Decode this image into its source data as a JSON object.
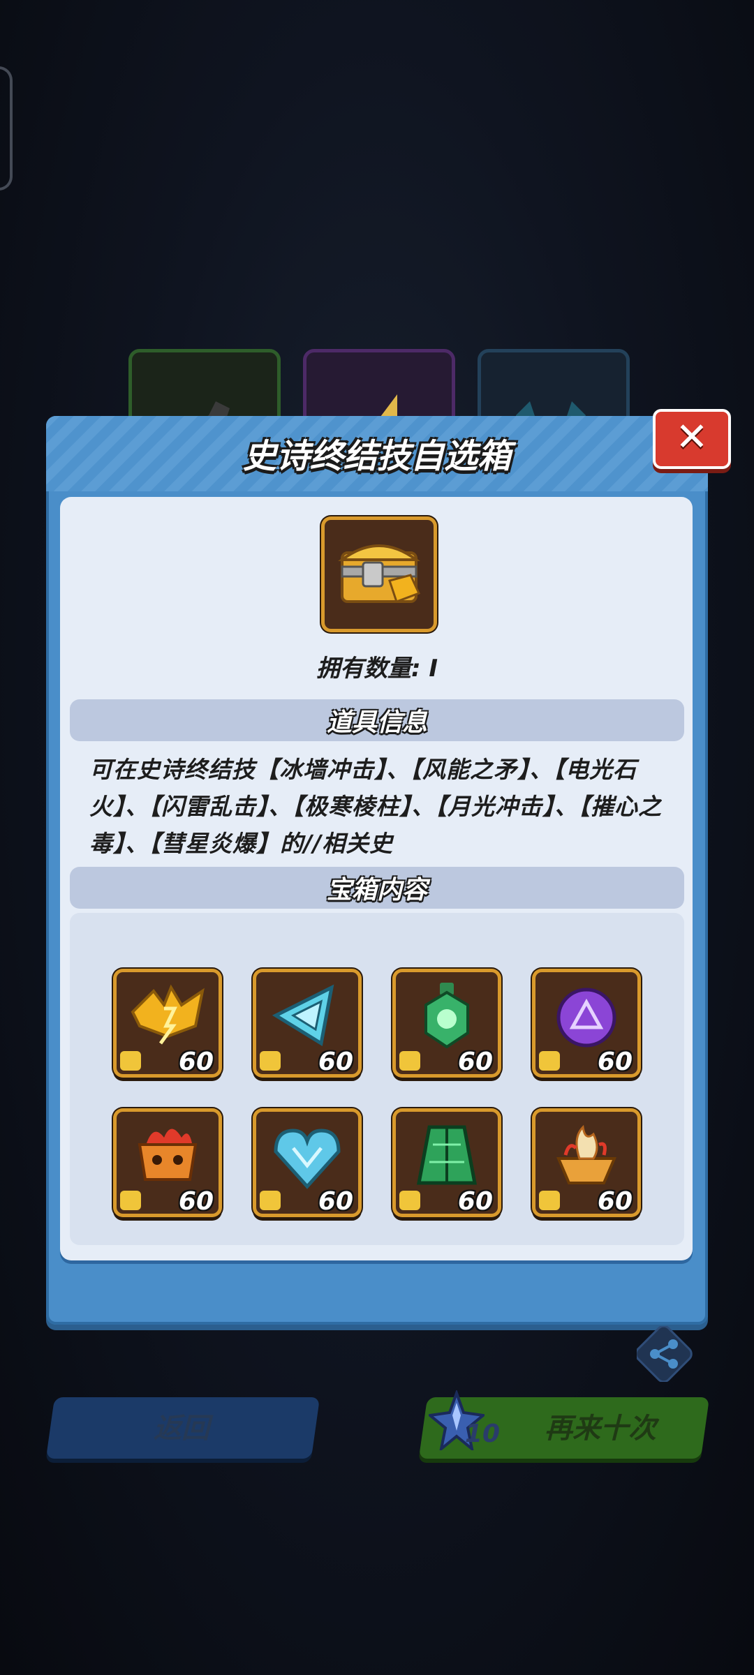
{
  "modal": {
    "title": "史诗终结技自选箱",
    "owned_label": "拥有数量: I",
    "section_info": "道具信息",
    "description": "可在史诗终结技【冰墙冲击】、【风能之矛】、【电光石火】、【闪雷乱击】、【极寒棱柱】、【月光冲击】、【摧心之毒】、【彗星炎爆】的//相关史",
    "section_contents": "宝箱内容",
    "close_icon": "close-icon"
  },
  "items": [
    {
      "name": "lightning-bat-icon",
      "qty": "60",
      "color": "#f2b21e"
    },
    {
      "name": "ice-triangle-icon",
      "qty": "60",
      "color": "#5fd2e8"
    },
    {
      "name": "green-lantern-icon",
      "qty": "60",
      "color": "#38b26a"
    },
    {
      "name": "purple-rune-icon",
      "qty": "60",
      "color": "#8b45d6"
    },
    {
      "name": "fire-cauldron-icon",
      "qty": "60",
      "color": "#e8862a"
    },
    {
      "name": "ice-heart-icon",
      "qty": "60",
      "color": "#5fc8e8"
    },
    {
      "name": "green-cloak-icon",
      "qty": "60",
      "color": "#2ea35a"
    },
    {
      "name": "flame-bowl-icon",
      "qty": "60",
      "color": "#e9a13a"
    }
  ],
  "buttons": {
    "back_label": "返回",
    "again_label": "再来十次",
    "cost": "10"
  },
  "colors": {
    "modal_blue": "#4a8ec9",
    "panel": "#e6edf7",
    "close_red": "#d83a2e",
    "item_frame": "#d99a2c"
  }
}
